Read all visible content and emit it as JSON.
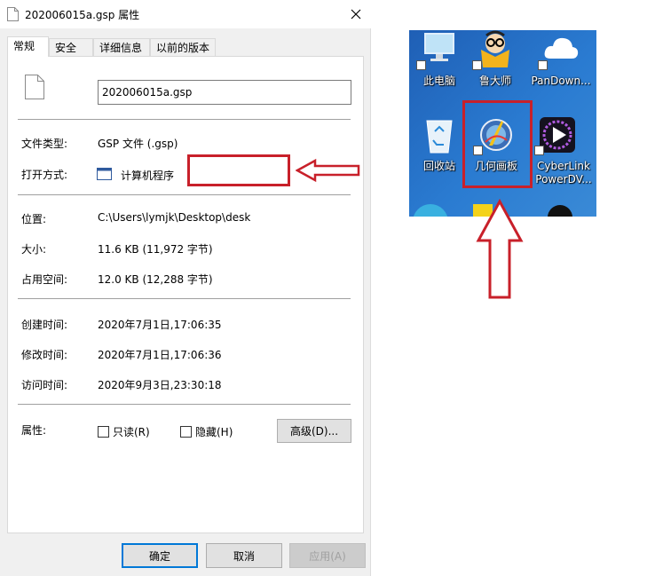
{
  "dialog": {
    "title": "202006015a.gsp 属性",
    "tabs": [
      {
        "label": "常规",
        "active": true
      },
      {
        "label": "安全",
        "active": false
      },
      {
        "label": "详细信息",
        "active": false
      },
      {
        "label": "以前的版本",
        "active": false
      }
    ],
    "file_name": "202006015a.gsp",
    "fields": {
      "type_label": "文件类型:",
      "type_value": "GSP 文件 (.gsp)",
      "open_label": "打开方式:",
      "open_value": "计算机程序",
      "location_label": "位置:",
      "location_value": "C:\\Users\\lymjk\\Desktop\\desk",
      "size_label": "大小:",
      "size_value": "11.6 KB (11,972 字节)",
      "disk_label": "占用空间:",
      "disk_value": "12.0 KB (12,288 字节)",
      "created_label": "创建时间:",
      "created_value": "2020年7月1日,17:06:35",
      "modified_label": "修改时间:",
      "modified_value": "2020年7月1日,17:06:36",
      "accessed_label": "访问时间:",
      "accessed_value": "2020年9月3日,23:30:18",
      "attr_label": "属性:"
    },
    "checkboxes": {
      "readonly": "只读(R)",
      "hidden": "隐藏(H)"
    },
    "buttons": {
      "advanced": "高级(D)...",
      "ok": "确定",
      "cancel": "取消",
      "apply": "应用(A)"
    }
  },
  "desktop": {
    "icons": [
      {
        "label": "此电脑"
      },
      {
        "label": "鲁大师"
      },
      {
        "label": "PanDown..."
      },
      {
        "label": "回收站"
      },
      {
        "label": "几何画板"
      },
      {
        "label": "CyberLink PowerDV..."
      }
    ]
  },
  "colors": {
    "annotation_red": "#c8202a",
    "desktop_blue": "#2a7bd1",
    "focus_blue": "#0078d7"
  }
}
